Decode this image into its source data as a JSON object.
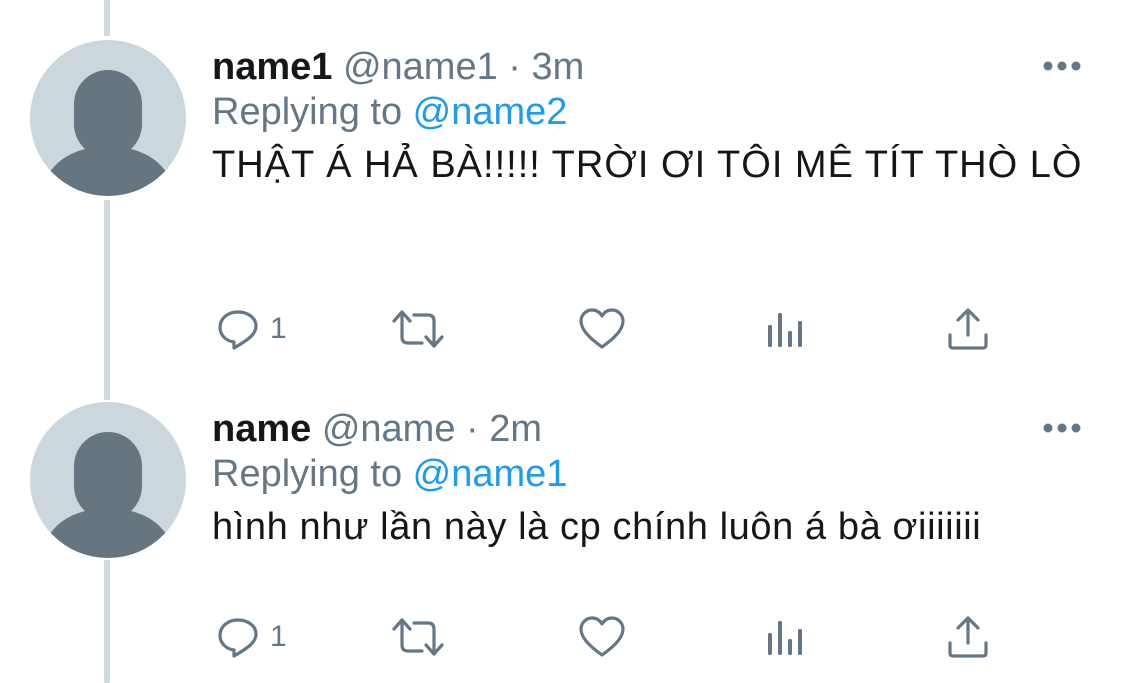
{
  "colors": {
    "accent": "#1d9bf0",
    "secondary_text": "#657786",
    "primary_text": "#14171a",
    "avatar_bg": "#ccd6dd",
    "avatar_fg": "#66757f",
    "thread_line": "#cfd9de"
  },
  "tweets": [
    {
      "display_name": "name1",
      "meta": " @name1 · 3m",
      "replying_prefix": "Replying to ",
      "replying_to": "@name2",
      "text": "THẬT Á HẢ BÀ!!!!! TRỜI ƠI TÔI MÊ TÍT THÒ LÒ",
      "reply_count": "1",
      "icons": [
        "reply-icon",
        "retweet-icon",
        "like-icon",
        "analytics-icon",
        "share-icon",
        "more-icon",
        "avatar-icon"
      ]
    },
    {
      "display_name": "name",
      "meta": " @name · 2m",
      "replying_prefix": "Replying to ",
      "replying_to": "@name1",
      "text": "hình như lần này là cp chính luôn á bà ơiiiiiii",
      "reply_count": "1",
      "icons": [
        "reply-icon",
        "retweet-icon",
        "like-icon",
        "analytics-icon",
        "share-icon",
        "more-icon",
        "avatar-icon"
      ]
    }
  ]
}
